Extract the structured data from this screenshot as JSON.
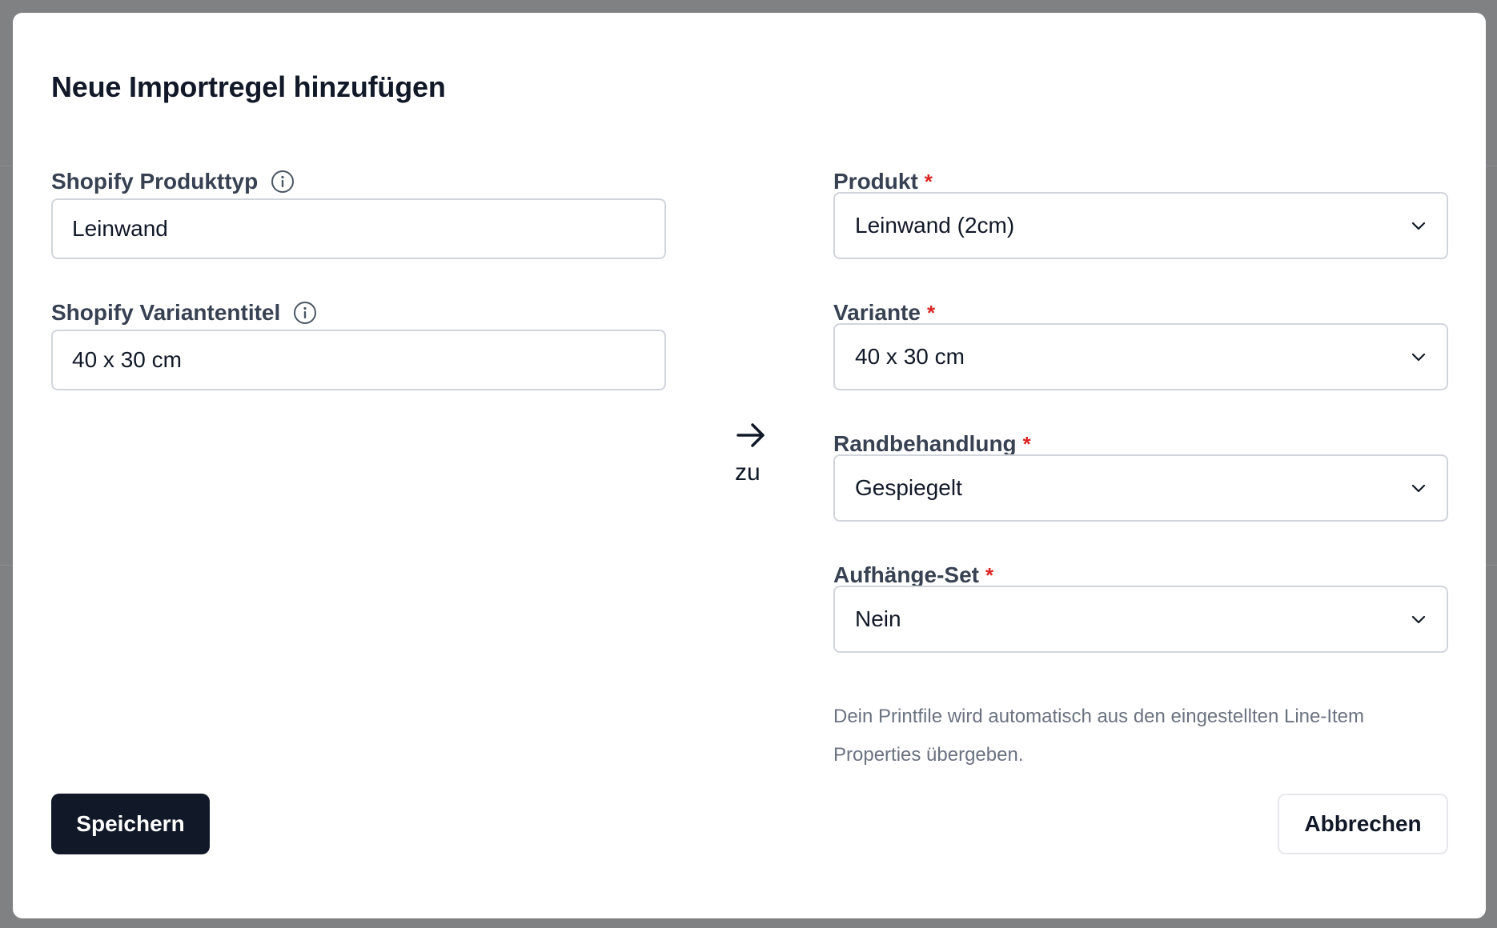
{
  "modal": {
    "title": "Neue Importregel hinzufügen"
  },
  "left": {
    "product_type": {
      "label": "Shopify Produkttyp",
      "value": "Leinwand",
      "icon": "info-icon"
    },
    "variant_title": {
      "label": "Shopify Variantentitel",
      "value": "40 x 30 cm",
      "icon": "info-icon"
    }
  },
  "mapping": {
    "icon": "arrow-right-icon",
    "label": "zu"
  },
  "right": {
    "product": {
      "label": "Produkt",
      "required_mark": "*",
      "value": "Leinwand (2cm)"
    },
    "variant": {
      "label": "Variante",
      "required_mark": "*",
      "value": "40 x 30 cm"
    },
    "edge": {
      "label": "Randbehandlung",
      "required_mark": "*",
      "value": "Gespiegelt"
    },
    "hanging": {
      "label": "Aufhänge-Set",
      "required_mark": "*",
      "value": "Nein"
    },
    "hint": "Dein Printfile wird automatisch aus den eingestellten Line-Item Properties übergeben."
  },
  "actions": {
    "save": "Speichern",
    "cancel": "Abbrechen"
  },
  "colors": {
    "primary_button": "#111827",
    "required": "#dc2626",
    "backdrop": "#808183"
  }
}
